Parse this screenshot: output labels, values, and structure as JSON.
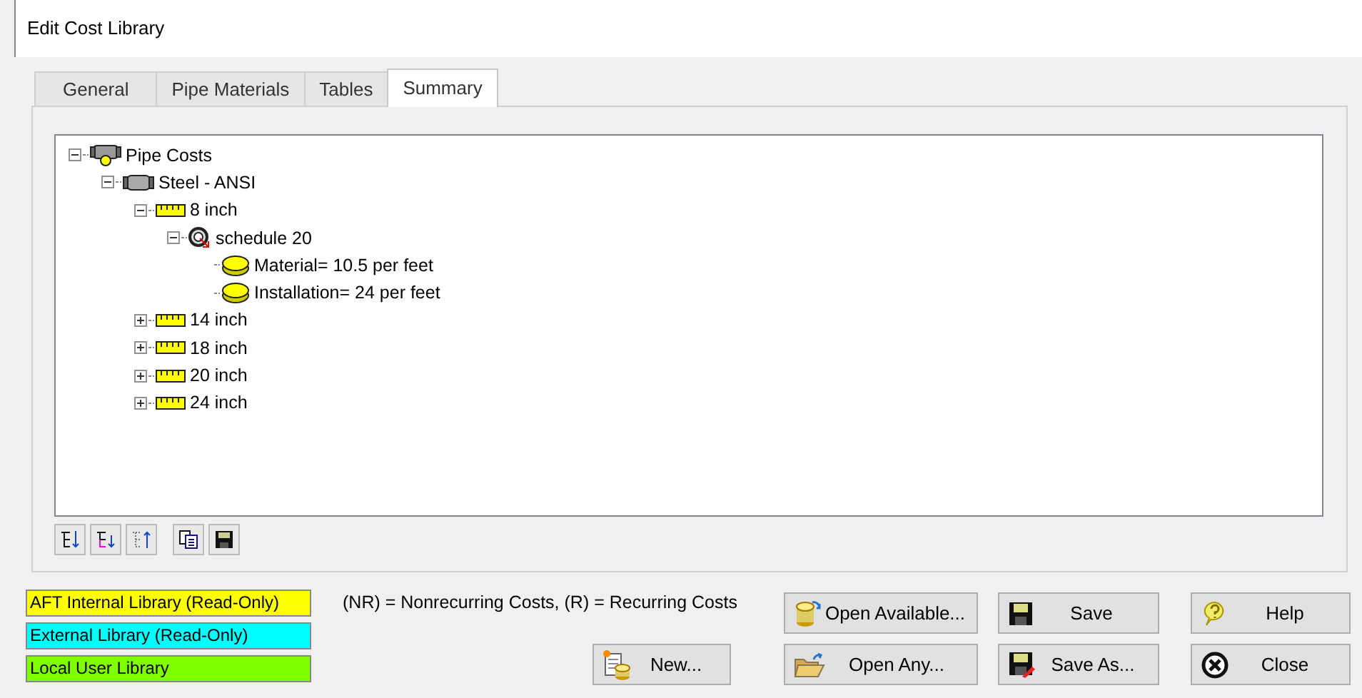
{
  "window": {
    "title": "Edit Cost Library"
  },
  "tabs": [
    {
      "label": "General",
      "selected": false
    },
    {
      "label": "Pipe Materials",
      "selected": false
    },
    {
      "label": "Tables",
      "selected": false
    },
    {
      "label": "Summary",
      "selected": true
    }
  ],
  "tree": [
    {
      "label": "Pipe Costs",
      "kind": "group",
      "expanded": true,
      "children": [
        {
          "label": "Steel - ANSI",
          "kind": "pipe",
          "expanded": true,
          "children": [
            {
              "label": "8 inch",
              "kind": "ruler",
              "expanded": true,
              "children": [
                {
                  "label": "schedule 20",
                  "kind": "schedule",
                  "expanded": true,
                  "children": [
                    {
                      "label": "Material= 10.5 per feet",
                      "kind": "coin"
                    },
                    {
                      "label": "Installation= 24 per feet",
                      "kind": "coin"
                    }
                  ]
                }
              ]
            },
            {
              "label": "14 inch",
              "kind": "ruler",
              "expanded": false
            },
            {
              "label": "18 inch",
              "kind": "ruler",
              "expanded": false
            },
            {
              "label": "20 inch",
              "kind": "ruler",
              "expanded": false
            },
            {
              "label": "24 inch",
              "kind": "ruler",
              "expanded": false
            }
          ]
        }
      ]
    }
  ],
  "legend": [
    {
      "label": "AFT Internal Library (Read-Only)",
      "color": "#ffff00"
    },
    {
      "label": "External Library (Read-Only)",
      "color": "#00ffff"
    },
    {
      "label": "Local User Library",
      "color": "#80ff00"
    }
  ],
  "note": "(NR) = Nonrecurring Costs, (R) = Recurring Costs",
  "buttons": [
    {
      "label": "Open Available...",
      "kind": "open-db"
    },
    {
      "label": "Save",
      "kind": "save"
    },
    {
      "label": "Help",
      "kind": "help"
    },
    {
      "label": "New...",
      "kind": "new"
    },
    {
      "label": "Open Any...",
      "kind": "folder"
    },
    {
      "label": "Save As...",
      "kind": "save-as"
    },
    {
      "label": "Close",
      "kind": "close"
    }
  ]
}
